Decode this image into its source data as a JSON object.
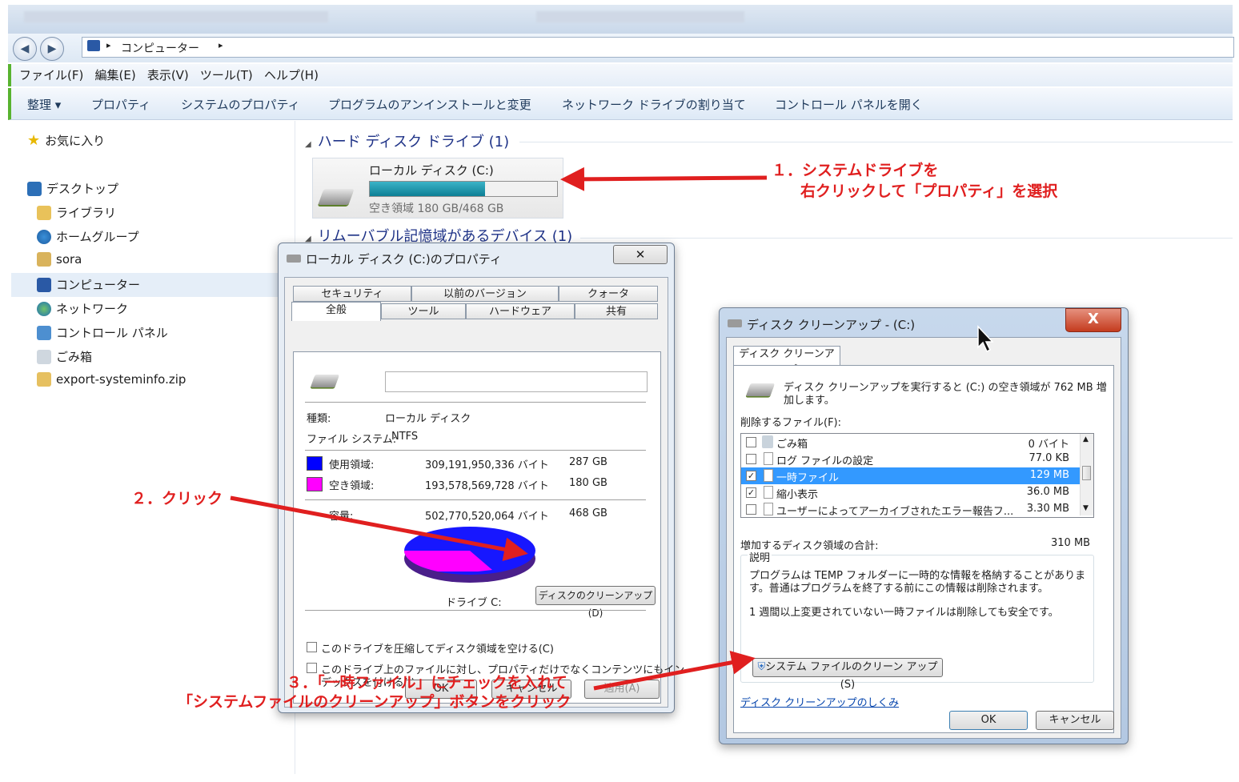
{
  "window": {
    "address": "コンピューター",
    "menu": [
      "ファイル(F)",
      "編集(E)",
      "表示(V)",
      "ツール(T)",
      "ヘルプ(H)"
    ],
    "commands": [
      "整理 ▾",
      "プロパティ",
      "システムのプロパティ",
      "プログラムのアンインストールと変更",
      "ネットワーク ドライブの割り当て",
      "コントロール パネルを開く"
    ]
  },
  "sidebar": {
    "favorites": "お気に入り",
    "items": [
      "デスクトップ",
      "ライブラリ",
      "ホームグループ",
      "sora",
      "コンピューター",
      "ネットワーク",
      "コントロール パネル",
      "ごみ箱",
      "export-systeminfo.zip"
    ]
  },
  "main": {
    "hdd_group": "ハード ディスク ドライブ (1)",
    "drive_name": "ローカル ディスク (C:)",
    "drive_free": "空き領域 180 GB/468 GB",
    "drive_used_fraction": 0.615,
    "removable_group": "リムーバブル記憶域があるデバイス (1)"
  },
  "props": {
    "title": "ローカル ディスク (C:)のプロパティ",
    "close": "✕",
    "tabs_back": [
      "セキュリティ",
      "以前のバージョン",
      "クォータ"
    ],
    "tabs_front": [
      "全般",
      "ツール",
      "ハードウェア",
      "共有"
    ],
    "type_label": "種類:",
    "type_value": "ローカル ディスク",
    "fs_label": "ファイル システム:",
    "fs_value": "NTFS",
    "used_label": "使用領域:",
    "used_bytes": "309,191,950,336 バイト",
    "used_gb": "287 GB",
    "free_label": "空き領域:",
    "free_bytes": "193,578,569,728 バイト",
    "free_gb": "180 GB",
    "cap_label": "容量:",
    "cap_bytes": "502,770,520,064 バイト",
    "cap_gb": "468 GB",
    "drive_label": "ドライブ C:",
    "cleanup_button": "ディスクのクリーンアップ(D)",
    "compress": "このドライブを圧縮してディスク領域を空ける(C)",
    "index_line1": "このドライブ上のファイルに対し、プロパティだけでなくコンテンツにもイン",
    "index_line2": "デックスを付ける(I)",
    "ok": "OK",
    "cancel": "キャンセル",
    "apply": "適用(A)",
    "used_color": "#0000ff",
    "free_color": "#ff00ff"
  },
  "cleanup": {
    "title": "ディスク クリーンアップ - (C:)",
    "close": "X",
    "tab": "ディスク クリーンアップ",
    "intro_line1": "ディスク クリーンアップを実行すると (C:) の空き領域が 762 MB 増",
    "intro_line2": "加します。",
    "files_label": "削除するファイル(F):",
    "files": [
      {
        "name": "ごみ箱",
        "size": "0 バイト",
        "checked": false
      },
      {
        "name": "ログ ファイルの設定",
        "size": "77.0 KB",
        "checked": false
      },
      {
        "name": "一時ファイル",
        "size": "129 MB",
        "checked": true
      },
      {
        "name": "縮小表示",
        "size": "36.0 MB",
        "checked": true
      },
      {
        "name": "ユーザーによってアーカイブされたエラー報告フ...",
        "size": "3.30 MB",
        "checked": false
      }
    ],
    "total_label": "増加するディスク領域の合計:",
    "total_value": "310 MB",
    "desc_label": "説明",
    "desc_line1": "プログラムは TEMP フォルダーに一時的な情報を格納することがありま",
    "desc_line2": "す。普通はプログラムを終了する前にこの情報は削除されます。",
    "desc_line3": "1 週間以上変更されていない一時ファイルは削除しても安全です。",
    "sysfile_button": "システム ファイルのクリーン アップ(S)",
    "howto_link": "ディスク クリーンアップのしくみ",
    "ok": "OK",
    "cancel": "キャンセル"
  },
  "annotations": {
    "step1_line1": "１．システムドライブを",
    "step1_line2": "右クリックして「プロパティ」を選択",
    "step2": "２．クリック",
    "step3_line1": "３．「一時ファイル」にチェックを入れて",
    "step3_line2": "「システムファイルのクリーンアップ」ボタンをクリック",
    "arrow_color": "#e01f1f"
  }
}
